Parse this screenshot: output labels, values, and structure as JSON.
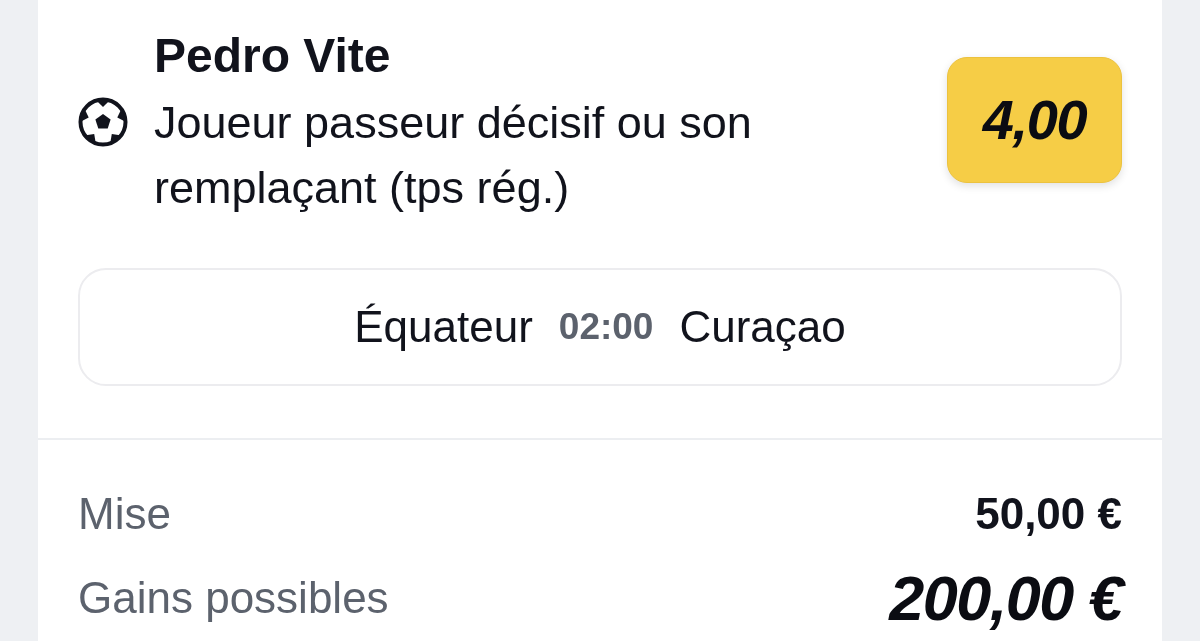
{
  "selection": {
    "player": "Pedro Vite",
    "market": "Joueur passeur décisif ou son remplaçant (tps rég.)",
    "odds": "4,00"
  },
  "match": {
    "home": "Équateur",
    "time": "02:00",
    "away": "Curaçao"
  },
  "summary": [
    {
      "kind": "stake",
      "label": "Mise",
      "value": "50,00 €"
    },
    {
      "kind": "payout",
      "label": "Gains possibles",
      "value": "200,00 €"
    }
  ]
}
